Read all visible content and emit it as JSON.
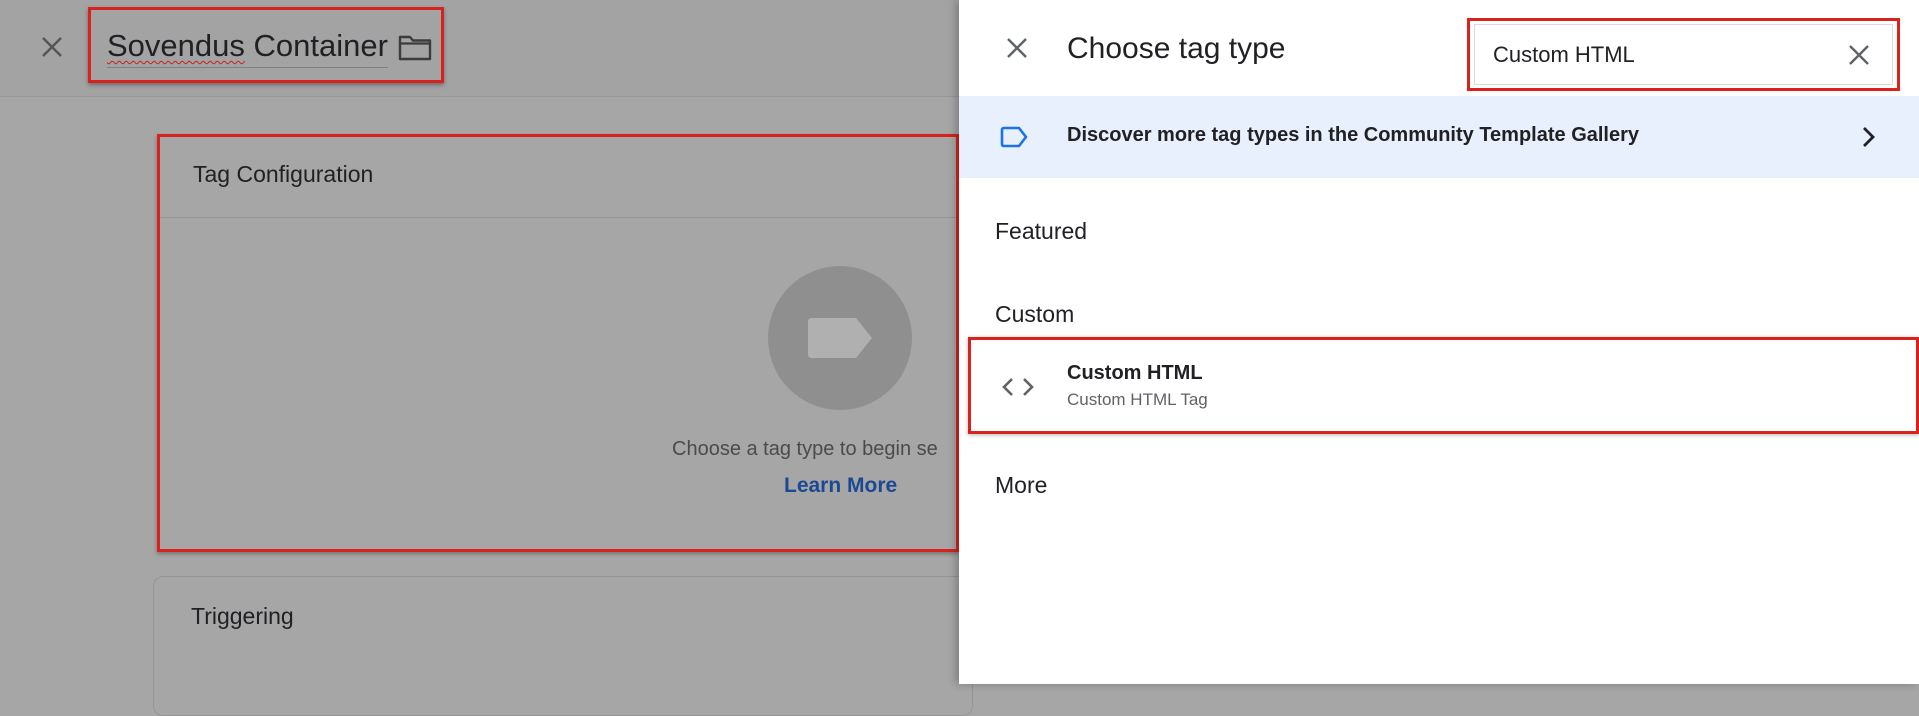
{
  "editor": {
    "tag_name_word1": "Sovendus",
    "tag_name_rest": " Container",
    "close_icon": "close-icon",
    "folder_icon": "folder-icon",
    "tag_configuration": {
      "title": "Tag Configuration",
      "placeholder_text": "Choose a tag type to begin se",
      "learn_more": "Learn More",
      "placeholder_icon": "tag-icon"
    },
    "triggering": {
      "title": "Triggering"
    }
  },
  "panel": {
    "title": "Choose tag type",
    "close_icon": "close-icon",
    "search": {
      "value": "Custom HTML",
      "clear_icon": "close-icon"
    },
    "gallery_banner": {
      "text": "Discover more tag types in the Community Template Gallery",
      "icon": "tag-outline-icon",
      "chevron": "chevron-right-icon"
    },
    "sections": {
      "featured": "Featured",
      "custom": "Custom",
      "more": "More"
    },
    "custom_items": [
      {
        "title": "Custom HTML",
        "subtitle": "Custom HTML Tag",
        "icon": "code-icon"
      }
    ]
  },
  "colors": {
    "highlight_red": "#d9221c",
    "link_blue": "#1c4a92",
    "banner_bg": "#e8f0fe",
    "tag_icon_blue": "#1a73e8",
    "overlay_gray": "#a6a6a6"
  }
}
